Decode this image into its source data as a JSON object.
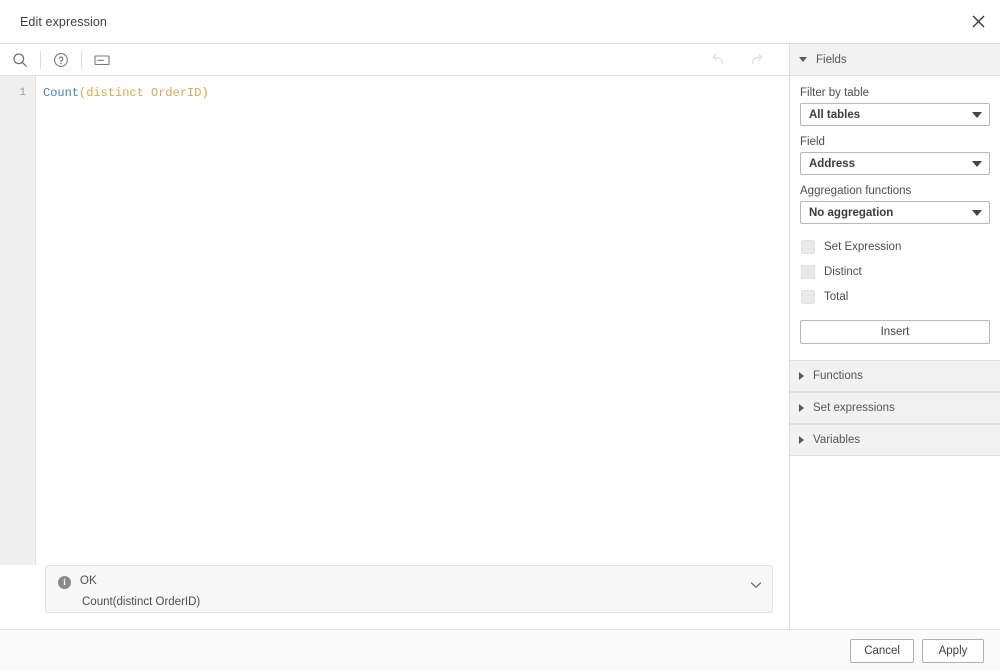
{
  "titlebar": {
    "title": "Edit expression",
    "close_icon": "close-icon"
  },
  "toolbar": {
    "search_icon": "search-icon",
    "help_icon": "help-circle-icon",
    "comment_icon": "comment-box-icon",
    "undo_icon": "undo-arrow-icon",
    "redo_icon": "redo-arrow-icon"
  },
  "editor": {
    "line_numbers": [
      "1"
    ],
    "expression": "Count(distinct OrderID)",
    "tokens": [
      {
        "text": "Count",
        "type": "function"
      },
      {
        "text": "(",
        "type": "operator"
      },
      {
        "text": "distinct",
        "type": "keyword"
      },
      {
        "text": " ",
        "type": "plain"
      },
      {
        "text": "OrderID",
        "type": "field"
      },
      {
        "text": ")",
        "type": "operator"
      }
    ]
  },
  "status": {
    "icon": "info-icon",
    "glyph": "i",
    "title": "OK",
    "detail": "Count(distinct OrderID)",
    "chevron_icon": "chevron-down-icon"
  },
  "panel": {
    "sections": [
      {
        "label": "Fields",
        "expanded": true
      },
      {
        "label": "Functions",
        "expanded": false
      },
      {
        "label": "Set expressions",
        "expanded": false
      },
      {
        "label": "Variables",
        "expanded": false
      }
    ],
    "fields": {
      "filter_by_table_label": "Filter by table",
      "filter_by_table_value": "All tables",
      "field_label": "Field",
      "field_value": "Address",
      "aggregation_label": "Aggregation functions",
      "aggregation_value": "No aggregation",
      "checkboxes": [
        {
          "label": "Set Expression",
          "checked": false
        },
        {
          "label": "Distinct",
          "checked": false
        },
        {
          "label": "Total",
          "checked": false
        }
      ],
      "insert_label": "Insert"
    }
  },
  "footer": {
    "cancel_label": "Cancel",
    "apply_label": "Apply"
  },
  "colors": {
    "accent_function": "#4b7fc4",
    "accent_keyword": "#e8a33d",
    "accent_field": "#e0a458",
    "panel_header_bg": "#f2f2f2",
    "status_bg": "#f7f7f7"
  }
}
